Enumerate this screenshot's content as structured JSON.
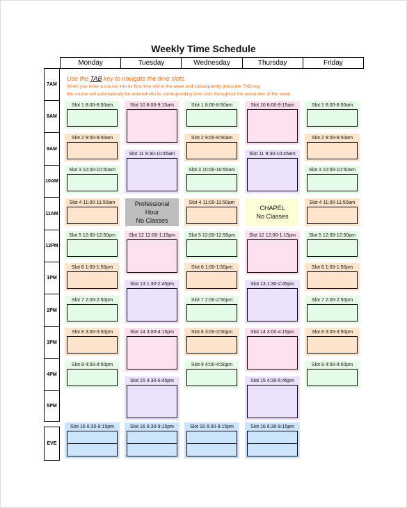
{
  "title": "Weekly Time Schedule",
  "days": [
    "Monday",
    "Tuesday",
    "Wednesday",
    "Thursday",
    "Friday"
  ],
  "times": [
    "7AM",
    "8AM",
    "9AM",
    "10AM",
    "11AM",
    "12PM",
    "1PM",
    "2PM",
    "3PM",
    "4PM",
    "5PM"
  ],
  "evening_label": "EVE",
  "instructions": {
    "line1_prefix": "Use the ",
    "line1_key": "TAB",
    "line1_suffix": " key to navigate the time slots.",
    "line2": "When you enter a course into its first time slot in the week and subsequently press the TAB key,",
    "line3": "the course will automatically be entered into its corresponding time slots throughout the remainder of the week."
  },
  "mwf_slots": [
    {
      "label": "Slot 1 8:00-8:50am",
      "color": "green"
    },
    {
      "label": "Slot 2 9:00-9:50am",
      "color": "orange"
    },
    {
      "label": "Slot 3 10:00-10:50am",
      "color": "green"
    },
    {
      "label": "Slot 4 11:00-11:50am",
      "color": "orange"
    },
    {
      "label": "Slot 5 12:00-12:50pm",
      "color": "green"
    },
    {
      "label": "Slot 6 1:00-1:50pm",
      "color": "orange"
    },
    {
      "label": "Slot 7 2:00-2:50pm",
      "color": "green"
    },
    {
      "label": "Slot 8 3:00-3:50pm",
      "color": "orange"
    },
    {
      "label": "Slot 9 4:00-4:50pm",
      "color": "green"
    }
  ],
  "tr_slots": [
    {
      "label": "Slot 10 8:00-9:15am",
      "color": "pink"
    },
    {
      "label": "Slot 11 9:30-10:45am",
      "color": "violet"
    },
    {
      "label": "Slot 12 12:00-1:15pm",
      "color": "pink"
    },
    {
      "label": "Slot 13 1:30-2:45pm",
      "color": "violet"
    },
    {
      "label": "Slot 14 3:00-4:15pm",
      "color": "pink"
    },
    {
      "label": "Slot 15 4:30-5:45pm",
      "color": "violet"
    }
  ],
  "evening_slot": {
    "label": "Slot 16 6:30-9:15pm",
    "days": [
      "Monday",
      "Tuesday",
      "Wednesday",
      "Thursday"
    ]
  },
  "tuesday_special": {
    "line1": "Professional",
    "line2": "Hour",
    "line3": "No Classes"
  },
  "thursday_special": {
    "line1": "CHAPEL",
    "line2": "No Classes"
  },
  "colors": {
    "green": "#e5fbe5",
    "orange": "#fde5cc",
    "pink": "#fde0ee",
    "violet": "#ece0fc",
    "blue": "#cce5fc",
    "instruction": "#f26b10",
    "gray": "#bdbdbd",
    "yellow": "#fefdd8"
  }
}
